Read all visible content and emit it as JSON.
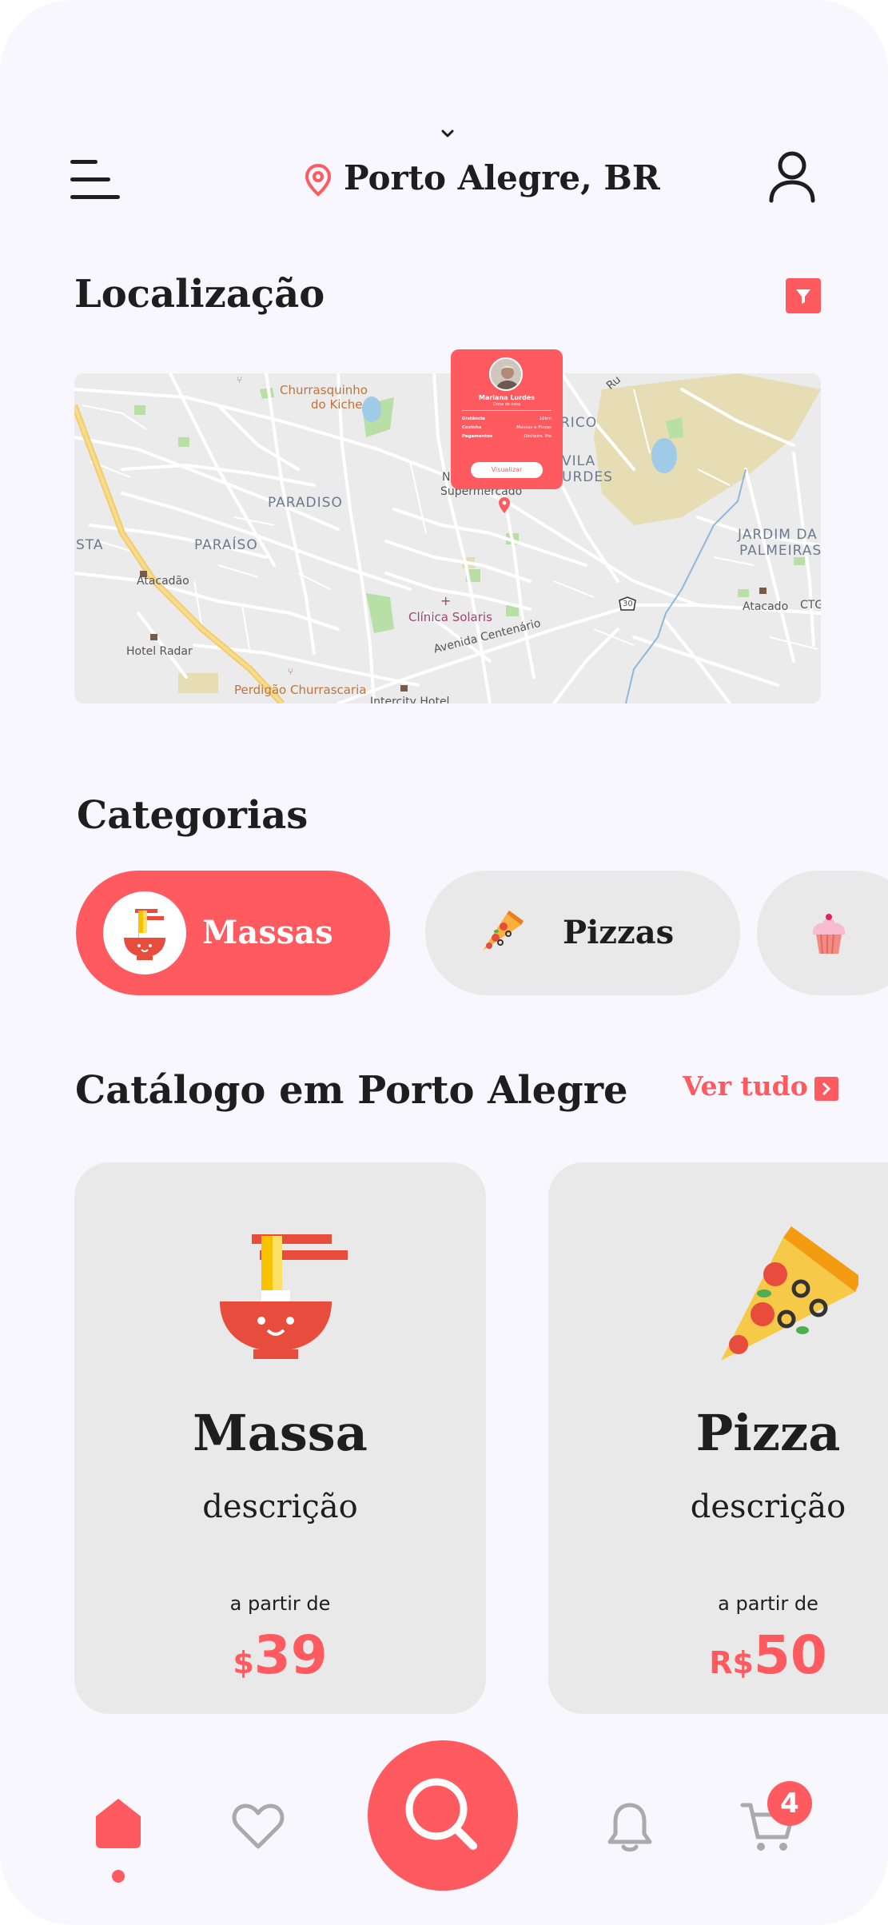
{
  "header": {
    "location": "Porto Alegre, BR"
  },
  "location_section": {
    "title": "Localização"
  },
  "map": {
    "labels": {
      "churrasquinho": "Churrasquinho",
      "do_kiche": "do Kiche",
      "paradiso": "PARADISO",
      "paraiso": "PARAÍSO",
      "sta": "STA",
      "atacadao": "Atacadão",
      "hotel_radar": "Hotel Radar",
      "perdigao": "Perdigão Churrascaria",
      "intercity": "Intercity Hotel",
      "supermercado": "Supermercado",
      "na": "Na",
      "clinica": "Clínica Solaris",
      "avenida": "Avenida Centenário",
      "rico": "RICO",
      "vila": "VILA",
      "urdes": "URDES",
      "jardim_da": "JARDIM DA",
      "palmeiras": "PALMEIRAS",
      "atacado": "Atacado",
      "ctg": "CTG",
      "road_number": "30",
      "ru": "Ru"
    },
    "card": {
      "name": "Mariana Lurdes",
      "subtitle": "Dona de casa",
      "rows": [
        {
          "label": "Distância",
          "value": "10km"
        },
        {
          "label": "Cozinha",
          "value": "Massas e Pizzas"
        },
        {
          "label": "Pagamentos",
          "value": "Dinheiro, Pix"
        }
      ],
      "button": "Visualizar"
    }
  },
  "categories": {
    "title": "Categorias",
    "items": [
      {
        "label": "Massas",
        "icon": "noodles-bowl-icon",
        "active": true
      },
      {
        "label": "Pizzas",
        "icon": "pizza-slice-icon",
        "active": false
      },
      {
        "label": "",
        "icon": "cupcake-icon",
        "active": false
      }
    ]
  },
  "catalog": {
    "title": "Catálogo em Porto Alegre",
    "see_all": "Ver tudo",
    "cards": [
      {
        "title": "Massa",
        "description": "descrição",
        "from_label": "a partir de",
        "currency": "$",
        "price": "39",
        "icon": "noodles-bowl-icon"
      },
      {
        "title": "Pizza",
        "description": "descrição",
        "from_label": "a partir de",
        "currency": "R$",
        "price": "50",
        "icon": "pizza-slice-icon"
      }
    ]
  },
  "bottom_nav": {
    "items": [
      "home-icon",
      "heart-icon",
      "search-icon",
      "bell-icon",
      "cart-icon"
    ],
    "active": "home-icon",
    "cart_count": "4"
  },
  "colors": {
    "accent": "#ff5a5f",
    "background": "#f7f7fd",
    "chip_inactive": "#e9e9e9",
    "text": "#1e1e1e"
  }
}
